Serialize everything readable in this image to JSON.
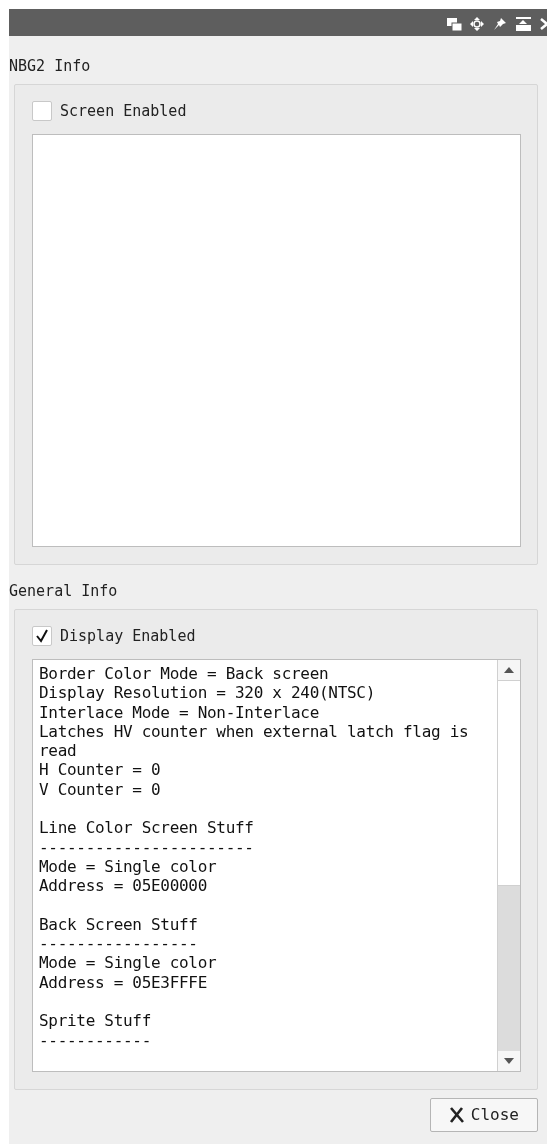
{
  "nbg2": {
    "title": "NBG2 Info",
    "checkbox": {
      "label": "Screen Enabled",
      "checked": false
    }
  },
  "general": {
    "title": "General Info",
    "checkbox": {
      "label": "Display Enabled",
      "checked": true
    },
    "info_blocks": [
      {
        "lines": [
          "Border Color Mode = Back screen",
          "Display Resolution = 320 x 240(NTSC)",
          "Interlace Mode = Non-Interlace",
          "Latches HV counter when external latch flag is read",
          "H Counter = 0",
          "V Counter = 0"
        ]
      },
      {
        "lines": [
          "Line Color Screen Stuff",
          "-----------------------",
          "Mode = Single color",
          "Address = 05E00000"
        ]
      },
      {
        "lines": [
          "Back Screen Stuff",
          "-----------------",
          "Mode = Single color",
          "Address = 05E3FFFE"
        ]
      },
      {
        "lines": [
          "Sprite Stuff",
          "------------"
        ]
      }
    ]
  },
  "close_button": {
    "label": "Close"
  }
}
